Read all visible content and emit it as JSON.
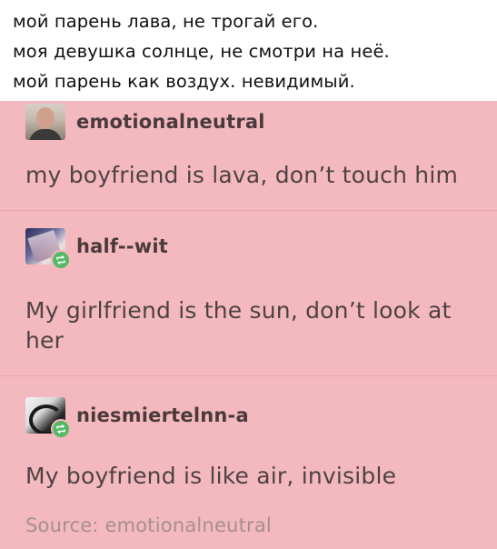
{
  "caption": {
    "lines": [
      "мой парень лава, не трогай его.",
      "моя девушка солнце, не смотри на неё.",
      "мой парень как воздух. невидимый."
    ]
  },
  "posts": [
    {
      "username": "emotionalneutral",
      "text": "my boyfriend is lava, don’t touch him",
      "avatar": "profile-photo"
    },
    {
      "username": "half--wit",
      "text": "My girlfriend is the sun, don’t look at her",
      "avatar": "profile-photo",
      "reblog_icon": "reblog-icon"
    },
    {
      "username": "niesmiertelnn-a",
      "text": "My boyfriend is like air, invisible",
      "avatar": "profile-photo",
      "reblog_icon": "reblog-icon"
    }
  ],
  "source": {
    "text": "Source: emotionalneutral"
  },
  "colors": {
    "post_background": "#f4b9bf",
    "reblog_badge": "#56b866",
    "text": "#4e4244",
    "source_text": "#a58f92"
  }
}
